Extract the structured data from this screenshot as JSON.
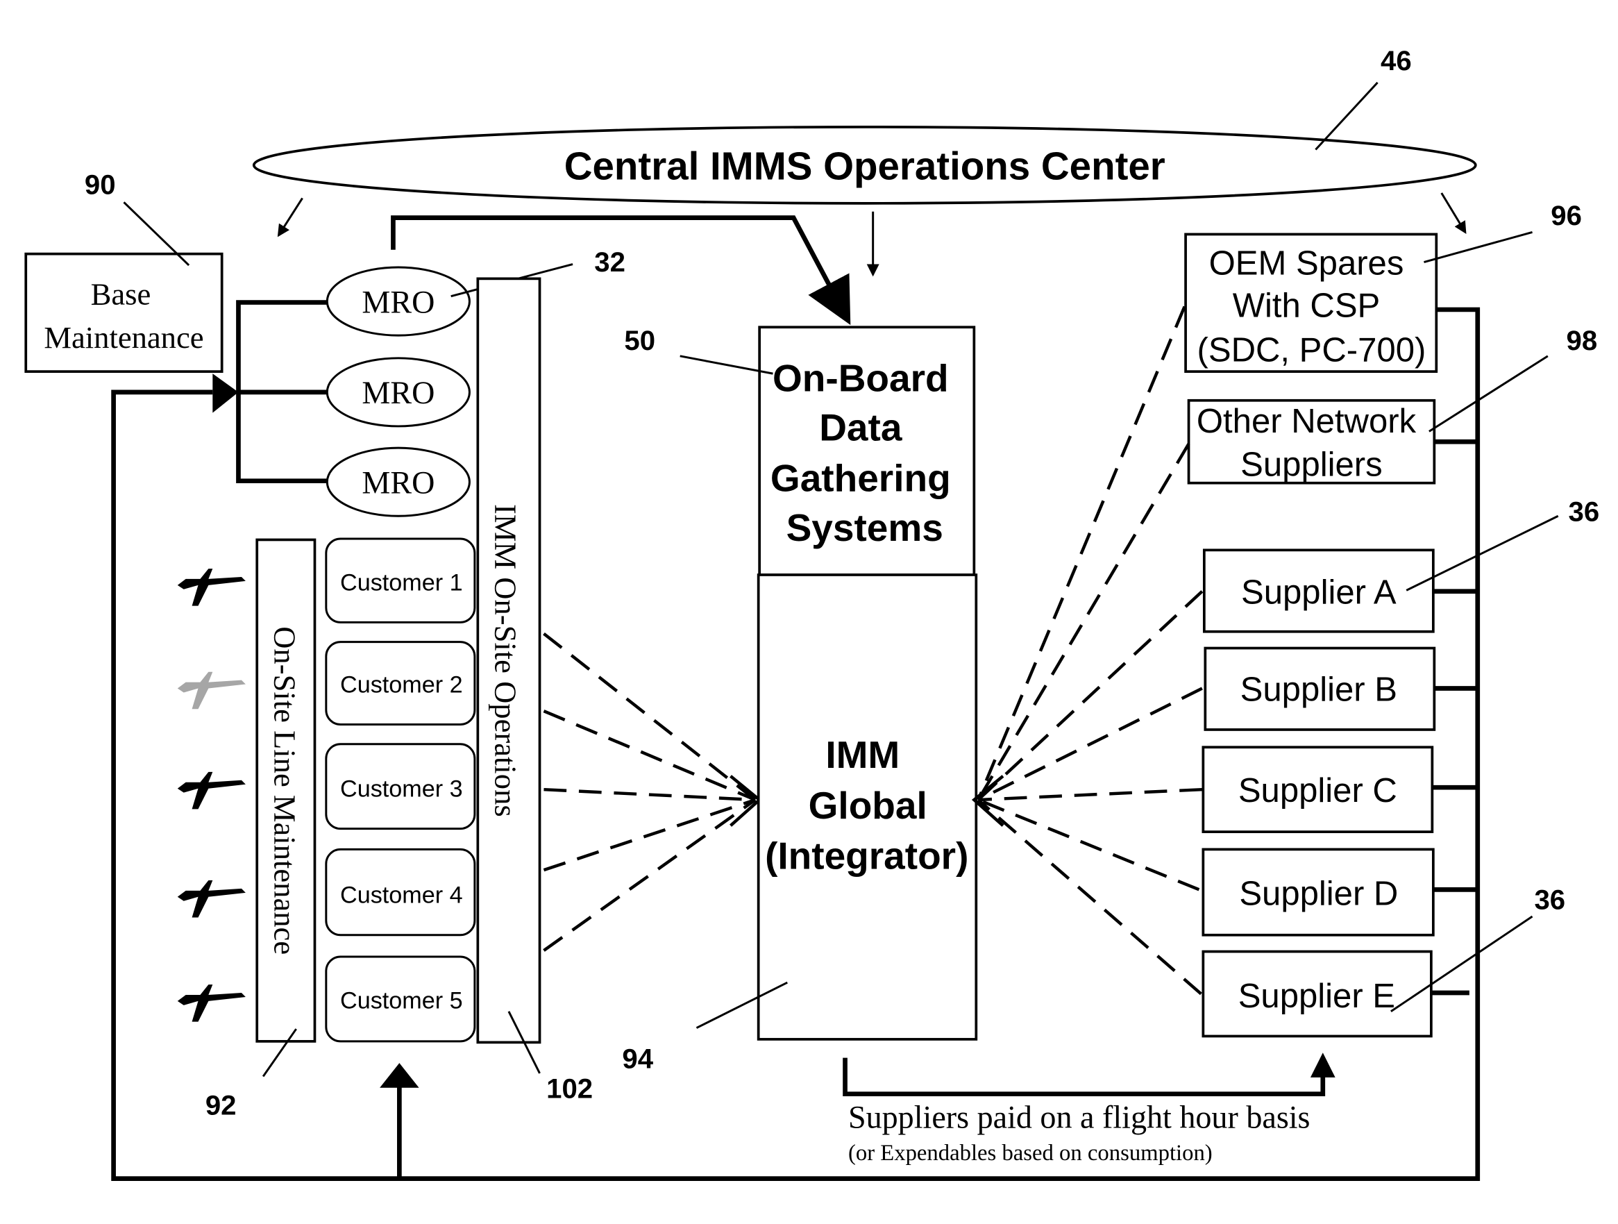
{
  "central_center": {
    "label": "Central IMMS Operations Center",
    "ref": "46"
  },
  "base_maintenance": {
    "line1": "Base",
    "line2": "Maintenance",
    "ref": "90"
  },
  "mro": {
    "items": [
      "MRO",
      "MRO",
      "MRO"
    ],
    "ref": "32"
  },
  "on_site_line_maintenance": {
    "label": "On-Site Line Maintenance",
    "ref": "92"
  },
  "imm_on_site_operations": {
    "label": "IMM On-Site Operations",
    "ref": "102"
  },
  "customers": [
    "Customer 1",
    "Customer 2",
    "Customer 3",
    "Customer 4",
    "Customer 5"
  ],
  "aircraft_icons": [
    "airplane-icon",
    "airplane-icon",
    "airplane-icon",
    "airplane-icon",
    "airplane-icon"
  ],
  "onboard": {
    "lines": [
      "On-Board",
      "Data",
      "Gathering",
      "Systems"
    ],
    "ref": "50"
  },
  "imm_global": {
    "lines": [
      "IMM",
      "Global",
      "(Integrator)"
    ],
    "ref": "94"
  },
  "oem_spares": {
    "lines": [
      "OEM Spares",
      "With CSP",
      "(SDC, PC-700)"
    ],
    "ref": "96"
  },
  "other_network": {
    "lines": [
      "Other Network",
      "Suppliers"
    ],
    "ref": "98"
  },
  "suppliers": [
    "Supplier A",
    "Supplier B",
    "Supplier C",
    "Supplier D",
    "Supplier E"
  ],
  "supplier_refs": [
    "36",
    "36"
  ],
  "payment_note": {
    "line1": "Suppliers paid on a flight hour basis",
    "line2": "(or Expendables based on consumption)"
  }
}
